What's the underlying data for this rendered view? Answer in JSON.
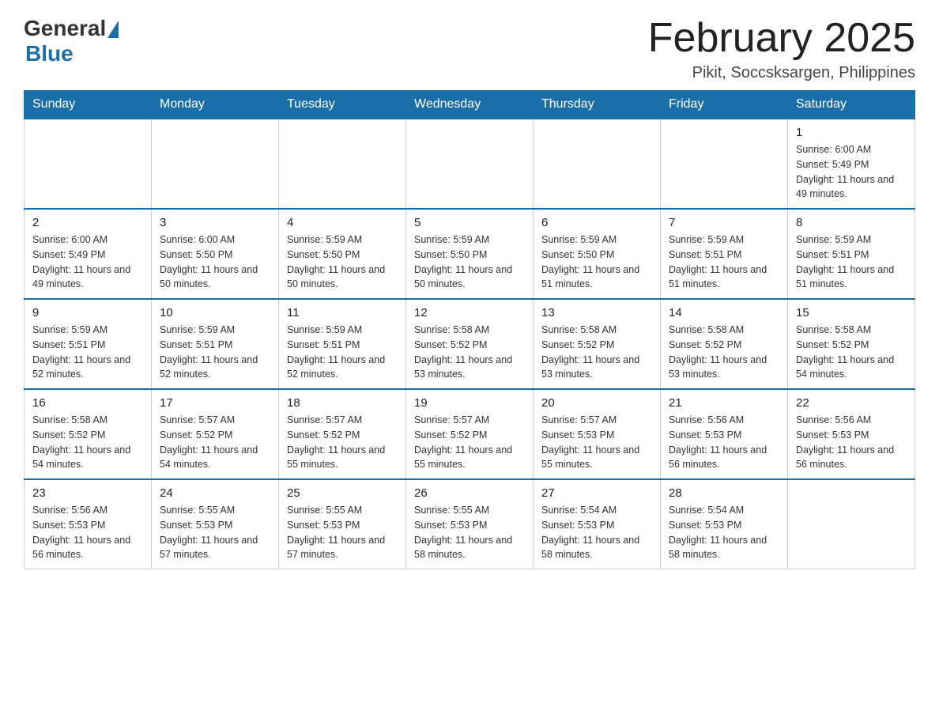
{
  "header": {
    "logo_general": "General",
    "logo_blue": "Blue",
    "month_title": "February 2025",
    "location": "Pikit, Soccsksargen, Philippines"
  },
  "days_of_week": [
    "Sunday",
    "Monday",
    "Tuesday",
    "Wednesday",
    "Thursday",
    "Friday",
    "Saturday"
  ],
  "weeks": [
    [
      {
        "day": "",
        "info": ""
      },
      {
        "day": "",
        "info": ""
      },
      {
        "day": "",
        "info": ""
      },
      {
        "day": "",
        "info": ""
      },
      {
        "day": "",
        "info": ""
      },
      {
        "day": "",
        "info": ""
      },
      {
        "day": "1",
        "info": "Sunrise: 6:00 AM\nSunset: 5:49 PM\nDaylight: 11 hours and 49 minutes."
      }
    ],
    [
      {
        "day": "2",
        "info": "Sunrise: 6:00 AM\nSunset: 5:49 PM\nDaylight: 11 hours and 49 minutes."
      },
      {
        "day": "3",
        "info": "Sunrise: 6:00 AM\nSunset: 5:50 PM\nDaylight: 11 hours and 50 minutes."
      },
      {
        "day": "4",
        "info": "Sunrise: 5:59 AM\nSunset: 5:50 PM\nDaylight: 11 hours and 50 minutes."
      },
      {
        "day": "5",
        "info": "Sunrise: 5:59 AM\nSunset: 5:50 PM\nDaylight: 11 hours and 50 minutes."
      },
      {
        "day": "6",
        "info": "Sunrise: 5:59 AM\nSunset: 5:50 PM\nDaylight: 11 hours and 51 minutes."
      },
      {
        "day": "7",
        "info": "Sunrise: 5:59 AM\nSunset: 5:51 PM\nDaylight: 11 hours and 51 minutes."
      },
      {
        "day": "8",
        "info": "Sunrise: 5:59 AM\nSunset: 5:51 PM\nDaylight: 11 hours and 51 minutes."
      }
    ],
    [
      {
        "day": "9",
        "info": "Sunrise: 5:59 AM\nSunset: 5:51 PM\nDaylight: 11 hours and 52 minutes."
      },
      {
        "day": "10",
        "info": "Sunrise: 5:59 AM\nSunset: 5:51 PM\nDaylight: 11 hours and 52 minutes."
      },
      {
        "day": "11",
        "info": "Sunrise: 5:59 AM\nSunset: 5:51 PM\nDaylight: 11 hours and 52 minutes."
      },
      {
        "day": "12",
        "info": "Sunrise: 5:58 AM\nSunset: 5:52 PM\nDaylight: 11 hours and 53 minutes."
      },
      {
        "day": "13",
        "info": "Sunrise: 5:58 AM\nSunset: 5:52 PM\nDaylight: 11 hours and 53 minutes."
      },
      {
        "day": "14",
        "info": "Sunrise: 5:58 AM\nSunset: 5:52 PM\nDaylight: 11 hours and 53 minutes."
      },
      {
        "day": "15",
        "info": "Sunrise: 5:58 AM\nSunset: 5:52 PM\nDaylight: 11 hours and 54 minutes."
      }
    ],
    [
      {
        "day": "16",
        "info": "Sunrise: 5:58 AM\nSunset: 5:52 PM\nDaylight: 11 hours and 54 minutes."
      },
      {
        "day": "17",
        "info": "Sunrise: 5:57 AM\nSunset: 5:52 PM\nDaylight: 11 hours and 54 minutes."
      },
      {
        "day": "18",
        "info": "Sunrise: 5:57 AM\nSunset: 5:52 PM\nDaylight: 11 hours and 55 minutes."
      },
      {
        "day": "19",
        "info": "Sunrise: 5:57 AM\nSunset: 5:52 PM\nDaylight: 11 hours and 55 minutes."
      },
      {
        "day": "20",
        "info": "Sunrise: 5:57 AM\nSunset: 5:53 PM\nDaylight: 11 hours and 55 minutes."
      },
      {
        "day": "21",
        "info": "Sunrise: 5:56 AM\nSunset: 5:53 PM\nDaylight: 11 hours and 56 minutes."
      },
      {
        "day": "22",
        "info": "Sunrise: 5:56 AM\nSunset: 5:53 PM\nDaylight: 11 hours and 56 minutes."
      }
    ],
    [
      {
        "day": "23",
        "info": "Sunrise: 5:56 AM\nSunset: 5:53 PM\nDaylight: 11 hours and 56 minutes."
      },
      {
        "day": "24",
        "info": "Sunrise: 5:55 AM\nSunset: 5:53 PM\nDaylight: 11 hours and 57 minutes."
      },
      {
        "day": "25",
        "info": "Sunrise: 5:55 AM\nSunset: 5:53 PM\nDaylight: 11 hours and 57 minutes."
      },
      {
        "day": "26",
        "info": "Sunrise: 5:55 AM\nSunset: 5:53 PM\nDaylight: 11 hours and 58 minutes."
      },
      {
        "day": "27",
        "info": "Sunrise: 5:54 AM\nSunset: 5:53 PM\nDaylight: 11 hours and 58 minutes."
      },
      {
        "day": "28",
        "info": "Sunrise: 5:54 AM\nSunset: 5:53 PM\nDaylight: 11 hours and 58 minutes."
      },
      {
        "day": "",
        "info": ""
      }
    ]
  ]
}
